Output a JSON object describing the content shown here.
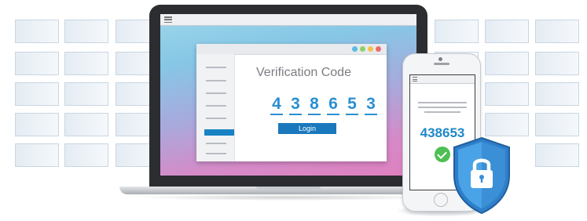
{
  "laptop_app": {
    "title": "Verification Code",
    "code_digits": [
      "4",
      "3",
      "8",
      "6",
      "5",
      "3"
    ],
    "login_label": "Login",
    "window_dots": [
      "#5bbbe3",
      "#8fd06a",
      "#f3c24d",
      "#ef6a6a"
    ]
  },
  "phone_app": {
    "code": "438653",
    "status": "verified"
  },
  "colors": {
    "accent": "#1a78bd",
    "code_blue": "#2a8fd1",
    "success_green": "#4fbf53",
    "shield_blue": "#3a8fd6"
  },
  "icons": [
    "menu-icon",
    "check-icon",
    "lock-icon",
    "shield-icon"
  ]
}
